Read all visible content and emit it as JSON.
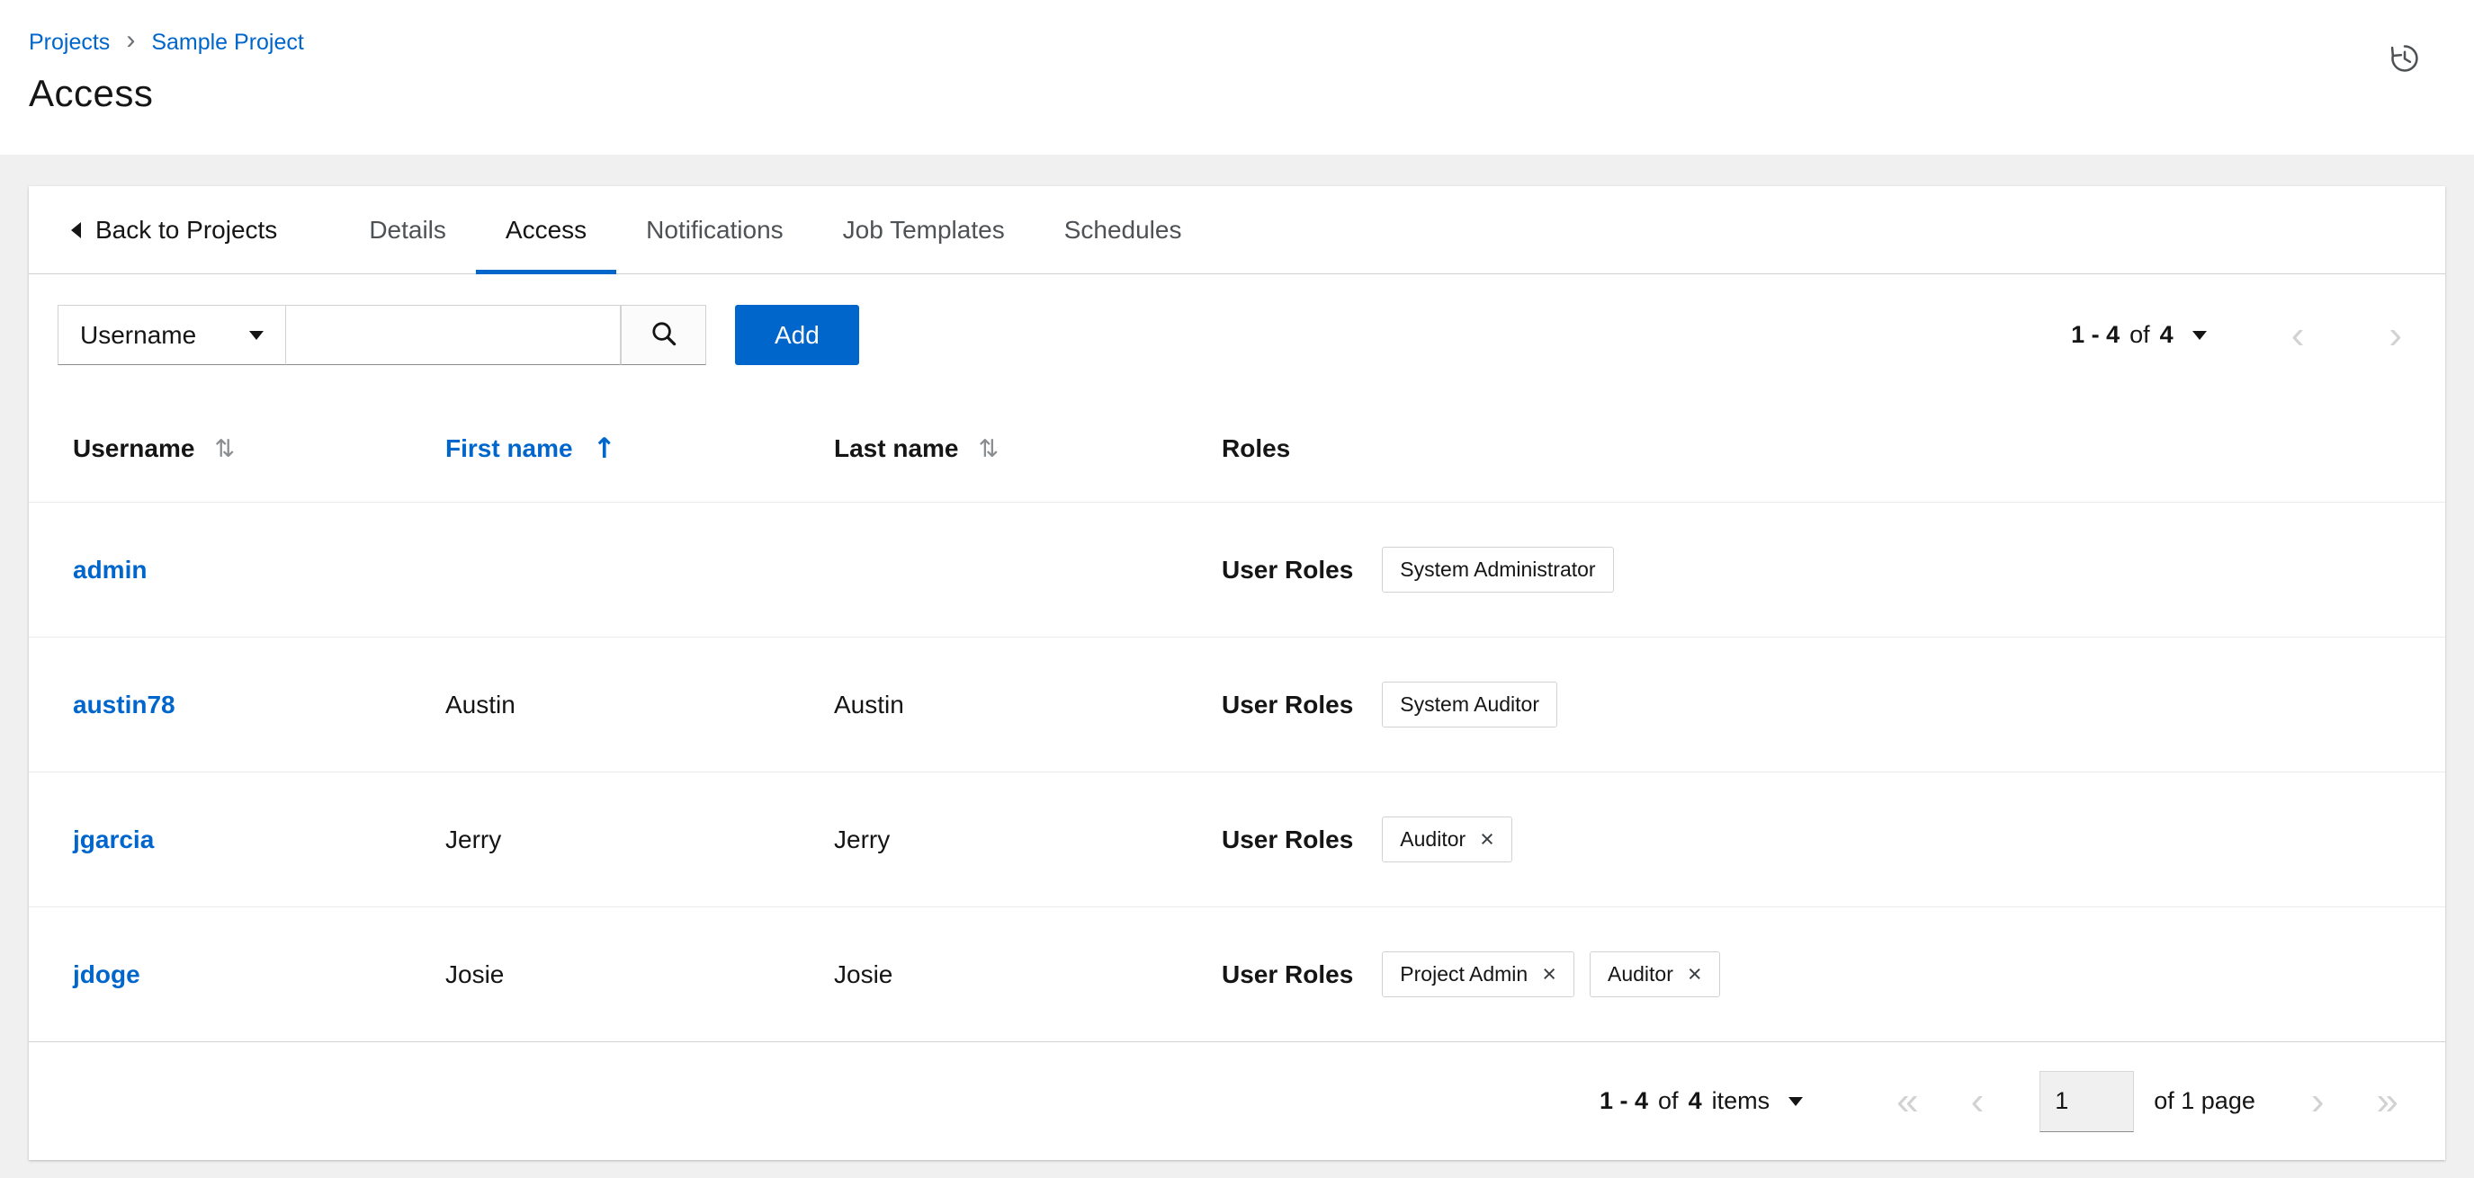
{
  "colors": {
    "primary": "#0066cc",
    "link": "#0066cc",
    "disabled": "#d2d2d2"
  },
  "header": {
    "breadcrumb": [
      {
        "label": "Projects"
      },
      {
        "label": "Sample Project"
      }
    ],
    "title": "Access"
  },
  "icons": {
    "breadcrumb_separator": "›",
    "sort_inactive": "⇅",
    "sort_ascending": "↑",
    "chip_close": "×",
    "first_page": "«",
    "previous_page": "‹",
    "next_page": "›",
    "last_page": "»"
  },
  "tabs": {
    "back_label": "Back to Projects",
    "items": [
      {
        "label": "Details",
        "active": false
      },
      {
        "label": "Access",
        "active": true
      },
      {
        "label": "Notifications",
        "active": false
      },
      {
        "label": "Job Templates",
        "active": false
      },
      {
        "label": "Schedules",
        "active": false
      }
    ]
  },
  "toolbar": {
    "filter": {
      "selected": "Username"
    },
    "search": {
      "value": ""
    },
    "add_button": "Add",
    "pagination": {
      "range": "1 - 4",
      "of": "of",
      "total": "4"
    }
  },
  "table": {
    "headers": {
      "username": "Username",
      "first_name": "First name",
      "last_name": "Last name",
      "roles": "Roles"
    },
    "sort": {
      "active_column": "First name",
      "direction": "ascending"
    },
    "rows": [
      {
        "username": "admin",
        "first_name": "",
        "last_name": "",
        "roles_label": "User Roles",
        "chips": [
          {
            "label": "System Administrator",
            "removable": false
          }
        ]
      },
      {
        "username": "austin78",
        "first_name": "Austin",
        "last_name": "Austin",
        "roles_label": "User Roles",
        "chips": [
          {
            "label": "System Auditor",
            "removable": false
          }
        ]
      },
      {
        "username": "jgarcia",
        "first_name": "Jerry",
        "last_name": "Jerry",
        "roles_label": "User Roles",
        "chips": [
          {
            "label": "Auditor",
            "removable": true
          }
        ]
      },
      {
        "username": "jdoge",
        "first_name": "Josie",
        "last_name": "Josie",
        "roles_label": "User Roles",
        "chips": [
          {
            "label": "Project Admin",
            "removable": true
          },
          {
            "label": "Auditor",
            "removable": true
          }
        ]
      }
    ]
  },
  "footer": {
    "pagination": {
      "range": "1 - 4",
      "of": "of",
      "total": "4",
      "items_label": "items"
    },
    "page_input": "1",
    "page_of_label": "of 1 page"
  }
}
